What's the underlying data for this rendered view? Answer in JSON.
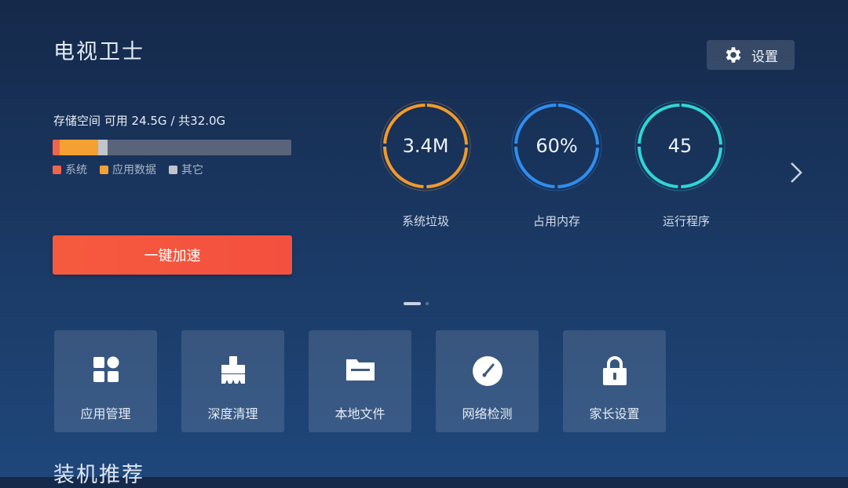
{
  "header": {
    "title": "电视卫士",
    "settings_label": "设置"
  },
  "storage": {
    "label": "存储空间 可用 24.5G / 共32.0G",
    "segments": [
      {
        "name": "系统",
        "color": "#f0644a"
      },
      {
        "name": "应用数据",
        "color": "#f5a032"
      },
      {
        "name": "其它",
        "color": "#c1c4cb"
      }
    ]
  },
  "boost_button": "一键加速",
  "gauges": [
    {
      "value": "3.4M",
      "label": "系统垃圾",
      "color": "#f39a2a"
    },
    {
      "value": "60%",
      "label": "占用内存",
      "color": "#2f8ef0"
    },
    {
      "value": "45",
      "label": "运行程序",
      "color": "#2fd6d6"
    }
  ],
  "tiles": [
    {
      "label": "应用管理",
      "icon": "apps-grid-icon"
    },
    {
      "label": "深度清理",
      "icon": "brush-icon"
    },
    {
      "label": "本地文件",
      "icon": "folder-icon"
    },
    {
      "label": "网络检测",
      "icon": "speedometer-icon"
    },
    {
      "label": "家长设置",
      "icon": "lock-icon"
    }
  ],
  "section_title": "装机推荐"
}
